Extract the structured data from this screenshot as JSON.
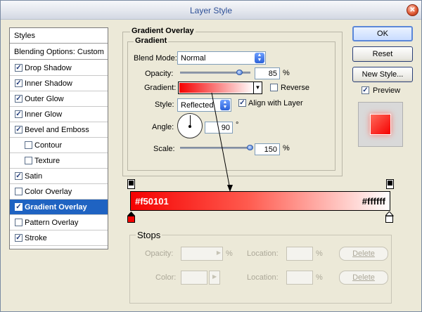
{
  "window": {
    "title": "Layer Style",
    "close_glyph": "✕"
  },
  "styles_panel": {
    "header": "Styles",
    "blending_options": "Blending Options: Custom",
    "items": [
      {
        "label": "Drop Shadow",
        "checked": true
      },
      {
        "label": "Inner Shadow",
        "checked": true
      },
      {
        "label": "Outer Glow",
        "checked": true
      },
      {
        "label": "Inner Glow",
        "checked": true
      },
      {
        "label": "Bevel and Emboss",
        "checked": true
      },
      {
        "label": "Contour",
        "checked": false
      },
      {
        "label": "Texture",
        "checked": false
      },
      {
        "label": "Satin",
        "checked": true
      },
      {
        "label": "Color Overlay",
        "checked": false
      },
      {
        "label": "Gradient Overlay",
        "checked": true,
        "selected": true
      },
      {
        "label": "Pattern Overlay",
        "checked": false
      },
      {
        "label": "Stroke",
        "checked": true
      }
    ]
  },
  "gradient_overlay": {
    "title": "Gradient Overlay",
    "section": "Gradient",
    "blend_mode_label": "Blend Mode:",
    "blend_mode_value": "Normal",
    "opacity_label": "Opacity:",
    "opacity_value": "85",
    "opacity_unit": "%",
    "opacity_slider": 0.85,
    "gradient_label": "Gradient:",
    "reverse_label": "Reverse",
    "reverse_checked": false,
    "style_label": "Style:",
    "style_value": "Reflected",
    "align_label": "Align with Layer",
    "align_checked": true,
    "angle_label": "Angle:",
    "angle_value": "90",
    "angle_unit": "°",
    "scale_label": "Scale:",
    "scale_value": "150",
    "scale_unit": "%",
    "scale_slider": 1.0
  },
  "buttons": {
    "ok": "OK",
    "reset": "Reset",
    "new_style": "New Style...",
    "preview_label": "Preview",
    "preview_checked": true
  },
  "gradient_editor": {
    "left_color": "#f50101",
    "right_color": "#ffffff",
    "left_label": "#f50101",
    "right_label": "#ffffff"
  },
  "stops": {
    "title": "Stops",
    "opacity_label": "Opacity:",
    "opacity_unit": "%",
    "location_label": "Location:",
    "location_unit": "%",
    "color_label": "Color:",
    "delete_label": "Delete"
  },
  "colors": {
    "selection": "#1f63c2",
    "accent": "#f50101"
  }
}
